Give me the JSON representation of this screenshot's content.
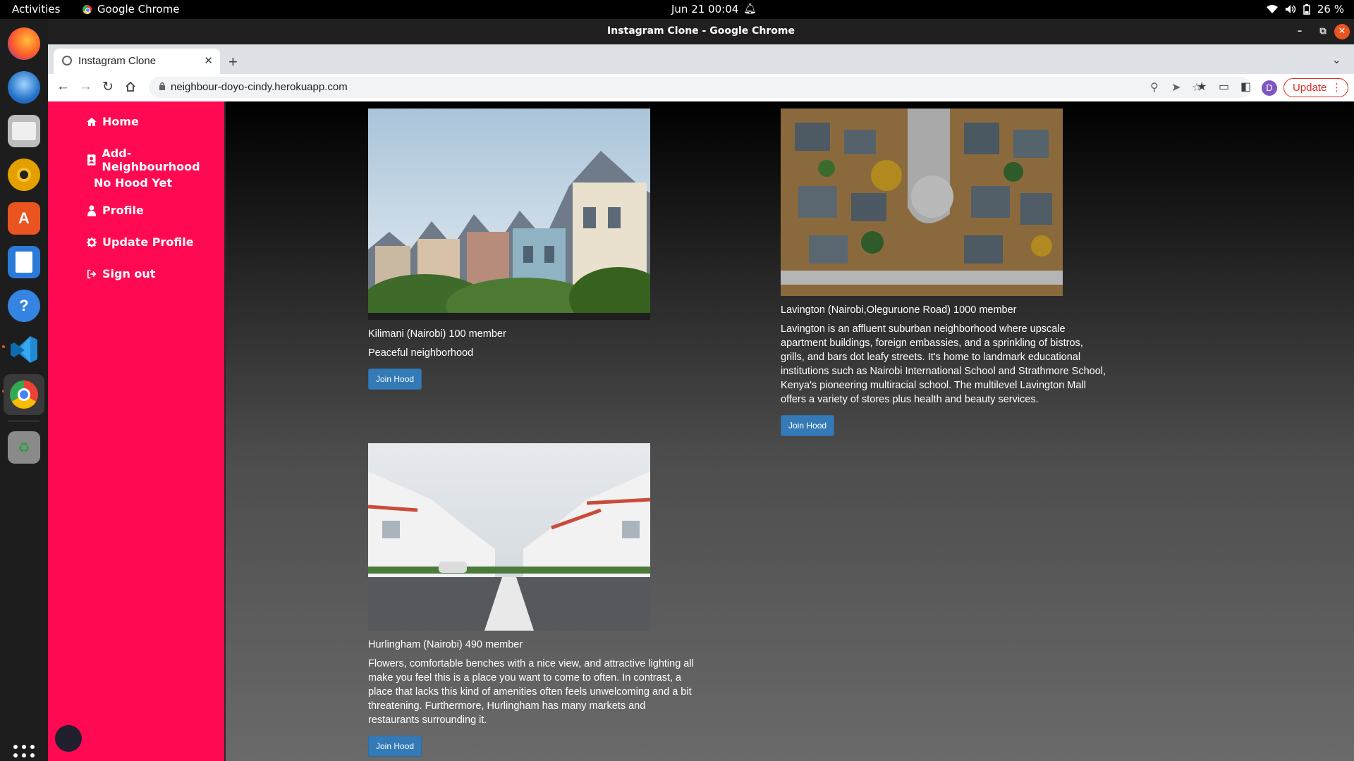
{
  "system": {
    "activities": "Activities",
    "app_name": "Google Chrome",
    "clock": "Jun 21  00:04",
    "battery": "26 %"
  },
  "window": {
    "title": "Instagram Clone - Google Chrome"
  },
  "browser": {
    "tab_title": "Instagram Clone",
    "url": "neighbour-doyo-cindy.herokuapp.com",
    "profile_initial": "D",
    "update_label": "Update"
  },
  "sidebar": {
    "items": [
      {
        "label": "Home",
        "icon": "home-icon"
      },
      {
        "label": "Add-Neighbourhood",
        "icon": "address-book-icon"
      },
      {
        "label": "No Hood Yet",
        "icon": ""
      },
      {
        "label": "Profile",
        "icon": "user-icon"
      },
      {
        "label": "Update Profile",
        "icon": "gear-icon"
      },
      {
        "label": "Sign out",
        "icon": "sign-out-icon"
      }
    ],
    "accent": "#ff0a52"
  },
  "hoods": [
    {
      "name": "Kilimani (Nairobi) 100 member",
      "description": "Peaceful neighborhood",
      "button": "Join Hood",
      "image": "victorian-houses-photo"
    },
    {
      "name": "Lavington (Nairobi,Oleguruone Road) 1000 member",
      "description": "Lavington is an affluent suburban neighborhood where upscale apartment buildings, foreign embassies, and a sprinkling of bistros, grills, and bars dot leafy streets. It's home to landmark educational institutions such as Nairobi International School and Strathmore School, Kenya's pioneering multiracial school. The multilevel Lavington Mall offers a variety of stores plus health and beauty services.",
      "button": "Join Hood",
      "image": "aerial-suburb-photo"
    },
    {
      "name": "Hurlingham (Nairobi) 490 member",
      "description": "Flowers, comfortable benches with a nice view, and attractive lighting all make you feel this is a place you want to come to often. In contrast, a place that lacks this kind of amenities often feels unwelcoming and a bit threatening. Furthermore, Hurlingham has many markets and restaurants surrounding it.",
      "button": "Join Hood",
      "image": "white-houses-street-photo"
    }
  ],
  "colors": {
    "button": "#337ab7",
    "page_gradient_top": "#000000",
    "page_gradient_bottom": "#6a6a6a"
  }
}
